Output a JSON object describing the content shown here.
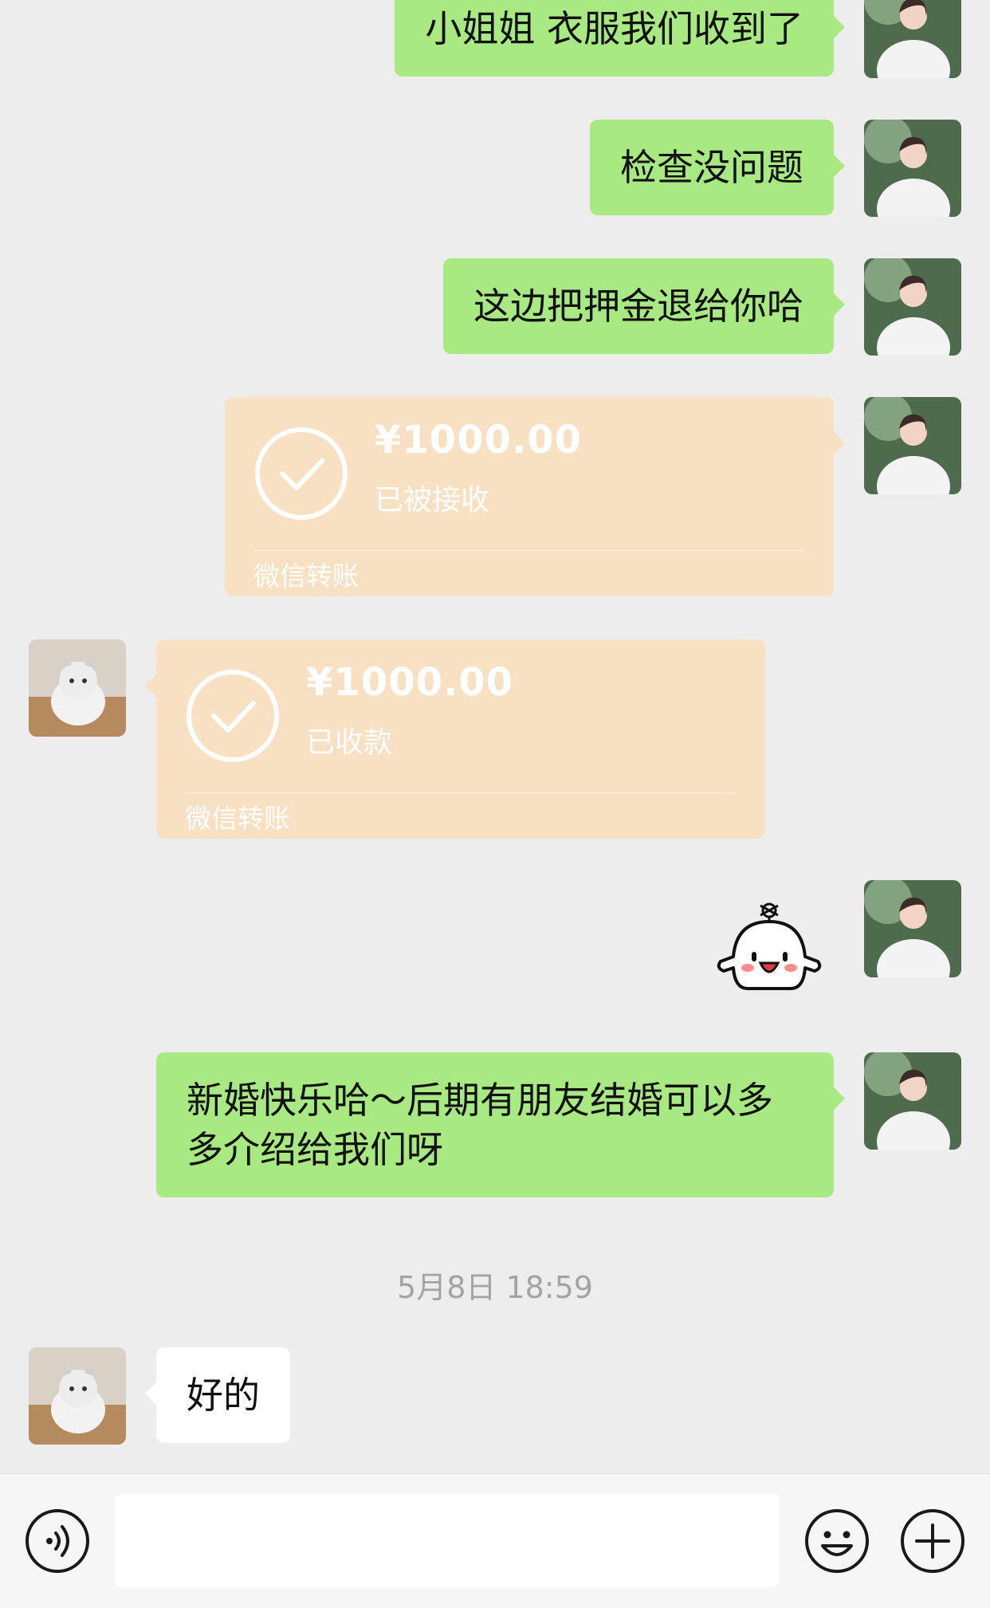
{
  "messages": {
    "m1": "小姐姐 衣服我们收到了",
    "m2": "检查没问题",
    "m3": "这边把押金退给你哈",
    "m6": "新婚快乐哈～后期有朋友结婚可以多多介绍给我们呀",
    "m7": "好的"
  },
  "transfers": [
    {
      "amount": "¥1000.00",
      "status": "已被接收",
      "label": "微信转账"
    },
    {
      "amount": "¥1000.00",
      "status": "已收款",
      "label": "微信转账"
    }
  ],
  "timestamp": "5月8日 18:59",
  "sticker": "smiling-ghost-sticker",
  "input": {
    "value": "",
    "placeholder": ""
  },
  "icons": [
    "voice-icon",
    "emoji-icon",
    "plus-icon"
  ],
  "colors": {
    "sent_bubble": "#a9e982",
    "received_bubble": "#ffffff",
    "transfer_card": "#f7e1c2",
    "background": "#ededed"
  }
}
